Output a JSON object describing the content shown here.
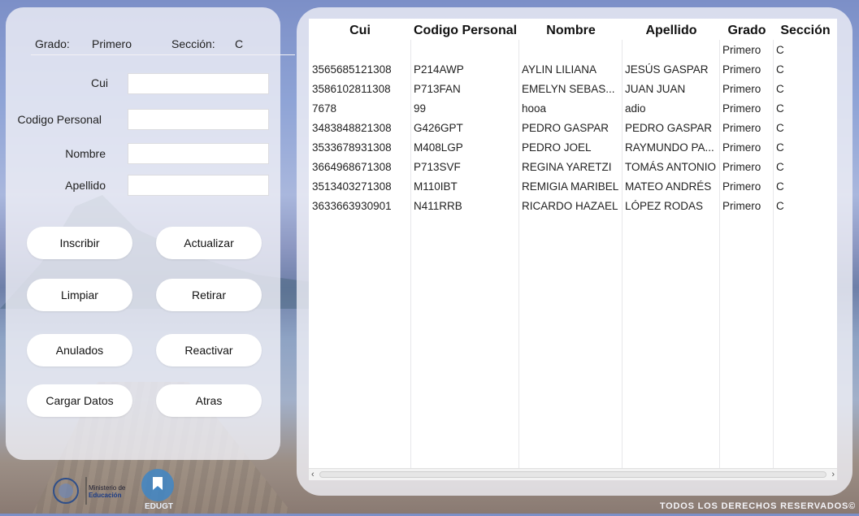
{
  "info": {
    "grado_label": "Grado:",
    "grado_value": "Primero",
    "seccion_label": "Sección:",
    "seccion_value": "C"
  },
  "form": {
    "cui_label": "Cui",
    "cui_value": "",
    "codigo_label": "Codigo Personal",
    "codigo_value": "",
    "nombre_label": "Nombre",
    "nombre_value": "",
    "apellido_label": "Apellido",
    "apellido_value": ""
  },
  "buttons": {
    "inscribir": "Inscribir",
    "actualizar": "Actualizar",
    "limpiar": "Limpiar",
    "retirar": "Retirar",
    "anulados": "Anulados",
    "reactivar": "Reactivar",
    "cargar_datos": "Cargar Datos",
    "atras": "Atras"
  },
  "table": {
    "headers": [
      "Cui",
      "Codigo Personal",
      "Nombre",
      "Apellido",
      "Grado",
      "Sección"
    ],
    "rows": [
      [
        "",
        "",
        "",
        "",
        "Primero",
        "C"
      ],
      [
        "3565685121308",
        "P214AWP",
        "AYLIN LILIANA",
        "JESÚS GASPAR",
        "Primero",
        "C"
      ],
      [
        "3586102811308",
        "P713FAN",
        "EMELYN SEBAS...",
        "JUAN JUAN",
        "Primero",
        "C"
      ],
      [
        "7678",
        "99",
        "hooa",
        "adio",
        "Primero",
        "C"
      ],
      [
        "3483848821308",
        "G426GPT",
        "PEDRO GASPAR",
        "PEDRO GASPAR",
        "Primero",
        "C"
      ],
      [
        "3533678931308",
        "M408LGP",
        "PEDRO JOEL",
        "RAYMUNDO PA...",
        "Primero",
        "C"
      ],
      [
        "3664968671308",
        "P713SVF",
        "REGINA YARETZI",
        "TOMÁS ANTONIO",
        "Primero",
        "C"
      ],
      [
        "3513403271308",
        "M110IBT",
        "REMIGIA MARIBEL",
        "MATEO ANDRÉS",
        "Primero",
        "C"
      ],
      [
        "3633663930901",
        "N411RRB",
        "RICARDO HAZAEL",
        "LÓPEZ RODAS",
        "Primero",
        "C"
      ]
    ]
  },
  "scroll": {
    "left_arrow": "‹",
    "right_arrow": "›"
  },
  "logos": {
    "ministerio_line1": "Ministerio de",
    "ministerio_line2": "Educación",
    "edugt": "EDUGT"
  },
  "footer": {
    "copyright": "TODOS LOS DERECHOS RESERVADOS©"
  },
  "colors": {
    "panel": "#f0f0f6",
    "button": "#ffffff",
    "logo_blue": "#3f86c6"
  }
}
